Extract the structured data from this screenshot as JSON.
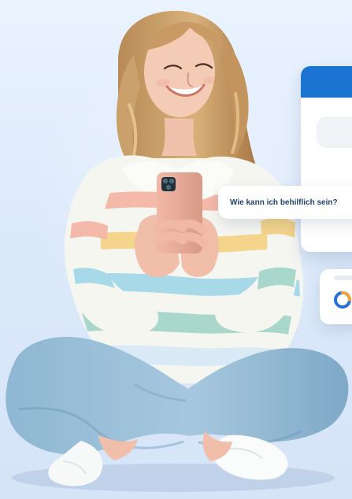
{
  "chat": {
    "message": "Wie kann ich behilflich sein?"
  },
  "icons": {
    "chat_bubble": "speech-bubble",
    "chart": "donut-chart-icon"
  },
  "colors": {
    "background": "#dce9fb",
    "app_header": "#1b74d1",
    "chat_text": "#21446b",
    "chart_blue": "#2a6fdb",
    "chart_orange": "#f2a33a"
  }
}
